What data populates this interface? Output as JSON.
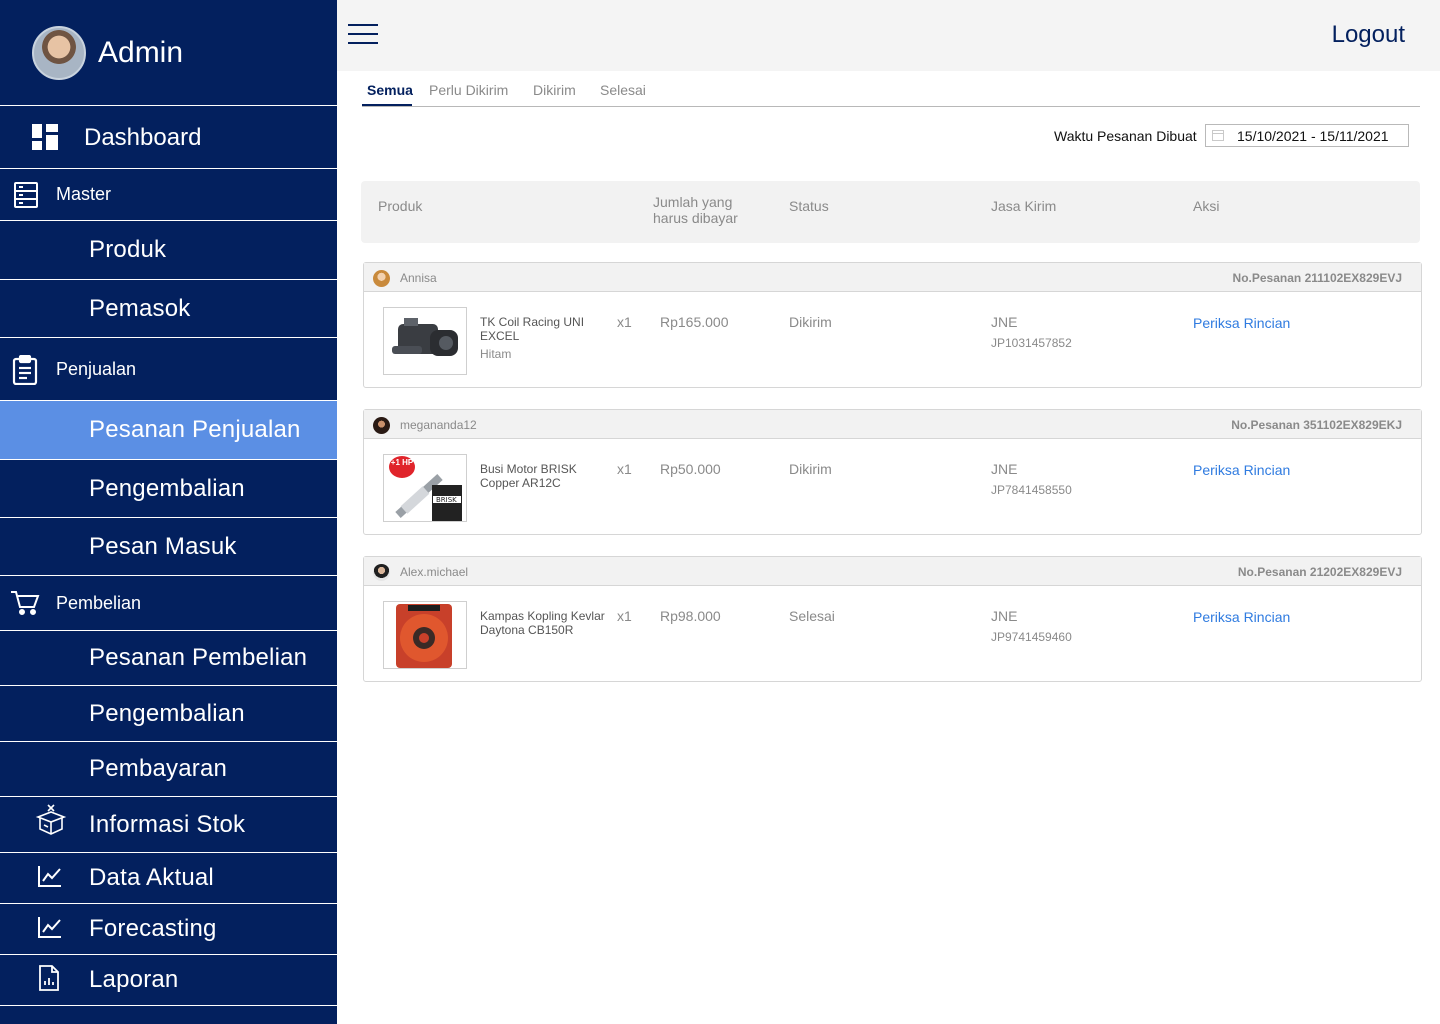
{
  "profile": {
    "name": "Admin"
  },
  "sidebar": {
    "dashboard": "Dashboard",
    "master": "Master",
    "produk": "Produk",
    "pemasok": "Pemasok",
    "penjualan": "Penjualan",
    "pesanan_penjualan": "Pesanan Penjualan",
    "pengembalian_penjualan": "Pengembalian",
    "pesan_masuk": "Pesan Masuk",
    "pembelian": "Pembelian",
    "pesanan_pembelian": "Pesanan Pembelian",
    "pengembalian_pembelian": "Pengembalian",
    "pembayaran": "Pembayaran",
    "informasi_stok": "Informasi Stok",
    "data_aktual": "Data Aktual",
    "forecasting": "Forecasting",
    "laporan": "Laporan"
  },
  "topbar": {
    "logout": "Logout"
  },
  "tabs": [
    "Semua",
    "Perlu Dikirim",
    "Dikirim",
    "Selesai"
  ],
  "filter": {
    "label": "Waktu Pesanan Dibuat",
    "date_range": "15/10/2021 - 15/11/2021"
  },
  "table": {
    "headers": {
      "produk": "Produk",
      "jumlah_line1": "Jumlah yang",
      "jumlah_line2": "harus dibayar",
      "status": "Status",
      "jasa_kirim": "Jasa Kirim",
      "aksi": "Aksi"
    }
  },
  "orders": [
    {
      "buyer": "Annisa",
      "order_no": "No.Pesanan 211102EX829EVJ",
      "product_name": "TK Coil Racing UNI EXCEL",
      "variant": "Hitam",
      "qty": "x1",
      "price": "Rp165.000",
      "status": "Dikirim",
      "courier": "JNE",
      "tracking": "JP1031457852",
      "action": "Periksa Rincian"
    },
    {
      "buyer": "megananda12",
      "order_no": "No.Pesanan 351102EX829EKJ",
      "product_name": "Busi Motor BRISK Copper AR12C",
      "variant": "",
      "qty": "x1",
      "price": "Rp50.000",
      "status": "Dikirim",
      "courier": "JNE",
      "tracking": "JP7841458550",
      "action": "Periksa Rincian",
      "badge": "+1 HP"
    },
    {
      "buyer": "Alex.michael",
      "order_no": "No.Pesanan 21202EX829EVJ",
      "product_name": "Kampas Kopling Kevlar Daytona CB150R",
      "variant": "",
      "qty": "x1",
      "price": "Rp98.000",
      "status": "Selesai",
      "courier": "JNE",
      "tracking": "JP9741459460",
      "action": "Periksa Rincian"
    }
  ],
  "colors": {
    "sidebar_bg": "#03205e",
    "sidebar_active": "#5b8fe4",
    "link": "#2f7be0",
    "muted_text": "#8a8a8a"
  }
}
